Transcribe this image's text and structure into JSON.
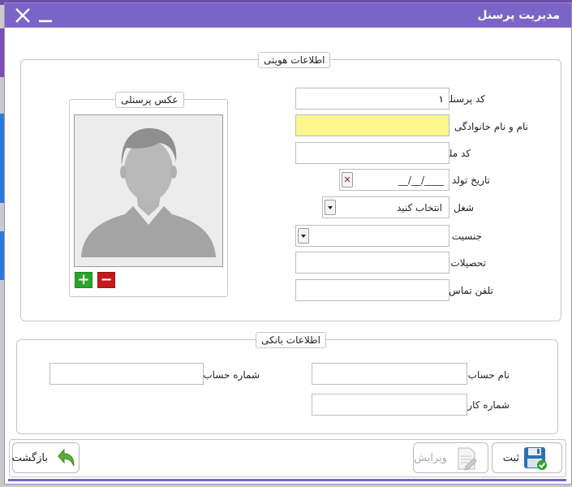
{
  "window": {
    "title": "مدیریت پرسنل"
  },
  "identity": {
    "legend": "اطلاعات هویتی",
    "personnel_code": {
      "label": "کد پرسنلی",
      "value": "۱"
    },
    "full_name": {
      "label": "نام و نام خانوادگی",
      "value": ""
    },
    "national_id": {
      "label": "کد ملی",
      "value": ""
    },
    "birth_date": {
      "label": "تاریخ تولد",
      "mask": "__/__/____"
    },
    "job": {
      "label": "شغل",
      "selected": "انتخاب کنید"
    },
    "gender": {
      "label": "جنسیت",
      "selected": ""
    },
    "education": {
      "label": "تحصیلات",
      "value": ""
    },
    "phone": {
      "label": "تلفن تماس",
      "value": ""
    }
  },
  "photo": {
    "legend": "عکس پرسنلی",
    "add_symbol": "+",
    "remove_symbol": "−"
  },
  "bank": {
    "legend": "اطلاعات بانکی",
    "account_name": {
      "label": "نام حساب",
      "value": ""
    },
    "account_number": {
      "label": "شماره حساب",
      "value": ""
    },
    "card_number": {
      "label": "شماره کارت",
      "value": ""
    }
  },
  "toolbar": {
    "save_label": "ثبت",
    "edit_label": "ویرایش",
    "back_label": "بازگشت"
  },
  "colors": {
    "titlebar": "#7b63c7",
    "required_field": "#fdf68f",
    "add_button": "#2aa52a",
    "remove_button": "#c21a1a"
  }
}
